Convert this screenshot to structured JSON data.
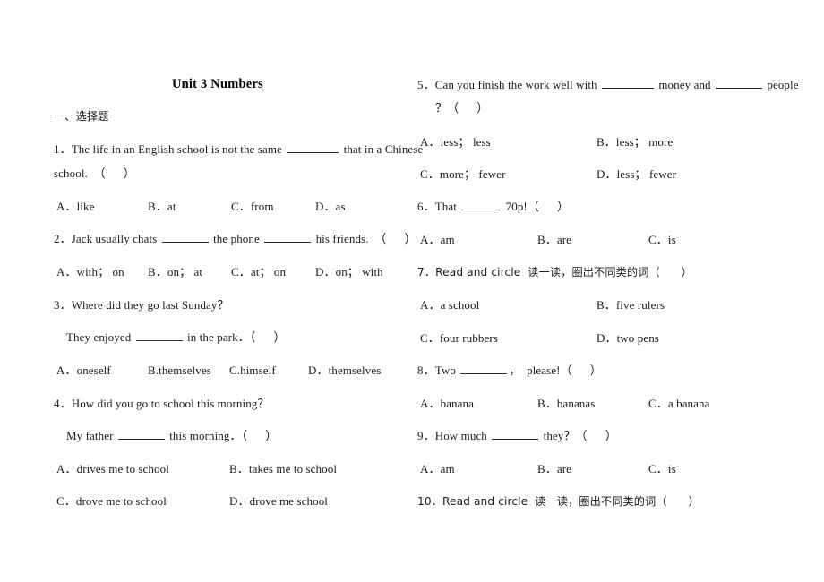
{
  "document": {
    "title": "Unit 3 Numbers",
    "section_heading": "一、选择题"
  },
  "left_column": {
    "q1": {
      "line1_a": "1．The life in an English school is not the same ",
      "line1_b": " that in a Chinese",
      "line2": "school.  （      ）",
      "options": [
        "A．like",
        "B．at",
        "C．from",
        "D．as"
      ]
    },
    "q2": {
      "line1_a": "2．Jack usually chats ",
      "line1_b": " the phone ",
      "line1_c": " his friends.  （      ）",
      "options": [
        "A．with； on",
        "B．on； at",
        "C．at； on",
        "D．on； with"
      ]
    },
    "q3": {
      "line1": "3．Where did they go last Sunday？",
      "line2_a": "They enjoyed ",
      "line2_b": " in the park．（      ）",
      "options": [
        "A．oneself",
        "B.themselves",
        "C.himself",
        "D．themselves"
      ]
    },
    "q4": {
      "line1": "4．How did you go to school this morning？",
      "line2_a": "My father ",
      "line2_b": " this morning．（      ）",
      "options": [
        "A．drives me to school",
        "B．takes me to school",
        "C．drove me to school",
        "D．drove me school"
      ]
    }
  },
  "right_column": {
    "q5": {
      "line1_a": "5．Can you finish the work well with ",
      "line1_b": " money and ",
      "line1_c": " people",
      "line2": "？（      ）",
      "options": [
        "A．less； less",
        "B．less； more",
        "C．more； fewer",
        "D．less； fewer"
      ]
    },
    "q6": {
      "line1_a": "6．That ",
      "line1_b": " 70p!（      ）",
      "options": [
        "A．am",
        "B．are",
        "C．is"
      ]
    },
    "q7": {
      "line1": "7．Read and circle  读一读，圈出不同类的词（      ）",
      "options": [
        "A．a school",
        "B．five rulers",
        "C．four rubbers",
        "D．two pens"
      ]
    },
    "q8": {
      "line1_a": "8．Two ",
      "line1_b": "，  please!（      ）",
      "options": [
        "A．banana",
        "B．bananas",
        "C．a banana"
      ]
    },
    "q9": {
      "line1_a": "9．How much ",
      "line1_b": " they？（      ）",
      "options": [
        "A．am",
        "B．are",
        "C．is"
      ]
    },
    "q10": {
      "line1": "10．Read and circle  读一读，圈出不同类的词（      ）"
    }
  }
}
